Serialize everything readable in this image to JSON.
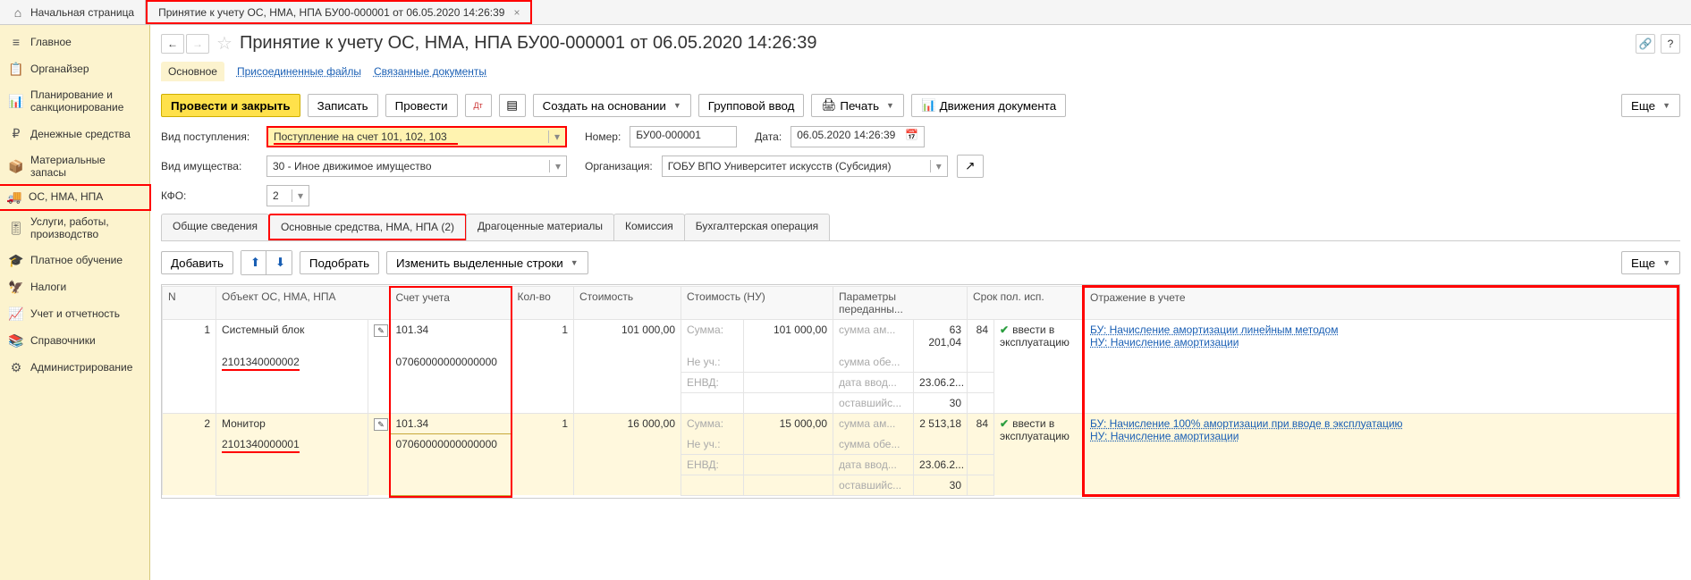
{
  "topbar": {
    "home": "Начальная страница",
    "tab1": "Принятие к учету ОС, НМА, НПА БУ00-000001 от 06.05.2020 14:26:39"
  },
  "sidebar": {
    "items": [
      "Главное",
      "Органайзер",
      "Планирование и санкционирование",
      "Денежные средства",
      "Материальные запасы",
      "ОС, НМА, НПА",
      "Услуги, работы, производство",
      "Платное обучение",
      "Налоги",
      "Учет и отчетность",
      "Справочники",
      "Администрирование"
    ]
  },
  "header": {
    "title": "Принятие к учету ОС, НМА, НПА БУ00-000001 от 06.05.2020 14:26:39",
    "nav_main": "Основное",
    "nav_files": "Присоединенные файлы",
    "nav_related": "Связанные документы"
  },
  "toolbar": {
    "post_close": "Провести и закрыть",
    "save": "Записать",
    "post": "Провести",
    "create_based": "Создать на основании",
    "group_input": "Групповой ввод",
    "print": "Печать",
    "movements": "Движения документа",
    "more": "Еще"
  },
  "form": {
    "vid_post_label": "Вид поступления:",
    "vid_post_value": "Поступление на счет 101, 102, 103",
    "nomer_label": "Номер:",
    "nomer_value": "БУ00-000001",
    "date_label": "Дата:",
    "date_value": "06.05.2020 14:26:39",
    "vid_imush_label": "Вид имущества:",
    "vid_imush_value": "30 - Иное движимое имущество",
    "org_label": "Организация:",
    "org_value": "ГОБУ ВПО Университет искусств (Субсидия)",
    "kfo_label": "КФО:",
    "kfo_value": "2"
  },
  "tabs": {
    "t1": "Общие сведения",
    "t2": "Основные средства, НМА, НПА (2)",
    "t3": "Драгоценные материалы",
    "t4": "Комиссия",
    "t5": "Бухгалтерская операция"
  },
  "subtoolbar": {
    "add": "Добавить",
    "pick": "Подобрать",
    "change_selected": "Изменить выделенные строки",
    "more": "Еще"
  },
  "table": {
    "headers": {
      "n": "N",
      "object": "Объект ОС, НМА, НПА",
      "account": "Счет учета",
      "qty": "Кол-во",
      "cost": "Стоимость",
      "cost_nu": "Стоимость (НУ)",
      "params": "Параметры переданны...",
      "term": "Срок пол. исп.",
      "reflect": "Отражение в учете"
    },
    "rows": [
      {
        "n": "1",
        "object_name": "Системный блок",
        "object_inv": "2101340000002",
        "account_code": "101.34",
        "account_detail": "07060000000000000",
        "qty": "1",
        "cost": "101 000,00",
        "nu_summa_label": "Сумма:",
        "nu_summa_val": "101 000,00",
        "nu_neuch_label": "Не уч.:",
        "nu_envd_label": "ЕНВД:",
        "param_sum_am_label": "сумма ам...",
        "param_sum_am_val": "63 201,04",
        "param_sum_ob_label": "сумма обе...",
        "param_date_label": "дата ввод...",
        "param_date_val": "23.06.2...",
        "param_rest_label": "оставшийс...",
        "param_rest_val": "30",
        "term_val": "84",
        "vvesti": "ввести в эксплуатацию",
        "reflect_bu": "БУ: Начисление амортизации линейным методом",
        "reflect_nu": "НУ: Начисление амортизации"
      },
      {
        "n": "2",
        "object_name": "Монитор",
        "object_inv": "2101340000001",
        "account_code": "101.34",
        "account_detail": "07060000000000000",
        "qty": "1",
        "cost": "16 000,00",
        "nu_summa_label": "Сумма:",
        "nu_summa_val": "15 000,00",
        "nu_neuch_label": "Не уч.:",
        "nu_envd_label": "ЕНВД:",
        "param_sum_am_label": "сумма ам...",
        "param_sum_am_val": "2 513,18",
        "param_sum_ob_label": "сумма обе...",
        "param_date_label": "дата ввод...",
        "param_date_val": "23.06.2...",
        "param_rest_label": "оставшийс...",
        "param_rest_val": "30",
        "term_val": "84",
        "vvesti": "ввести в эксплуатацию",
        "reflect_bu": "БУ: Начисление 100% амортизации при вводе в эксплуатацию",
        "reflect_nu": "НУ: Начисление амортизации"
      }
    ]
  }
}
